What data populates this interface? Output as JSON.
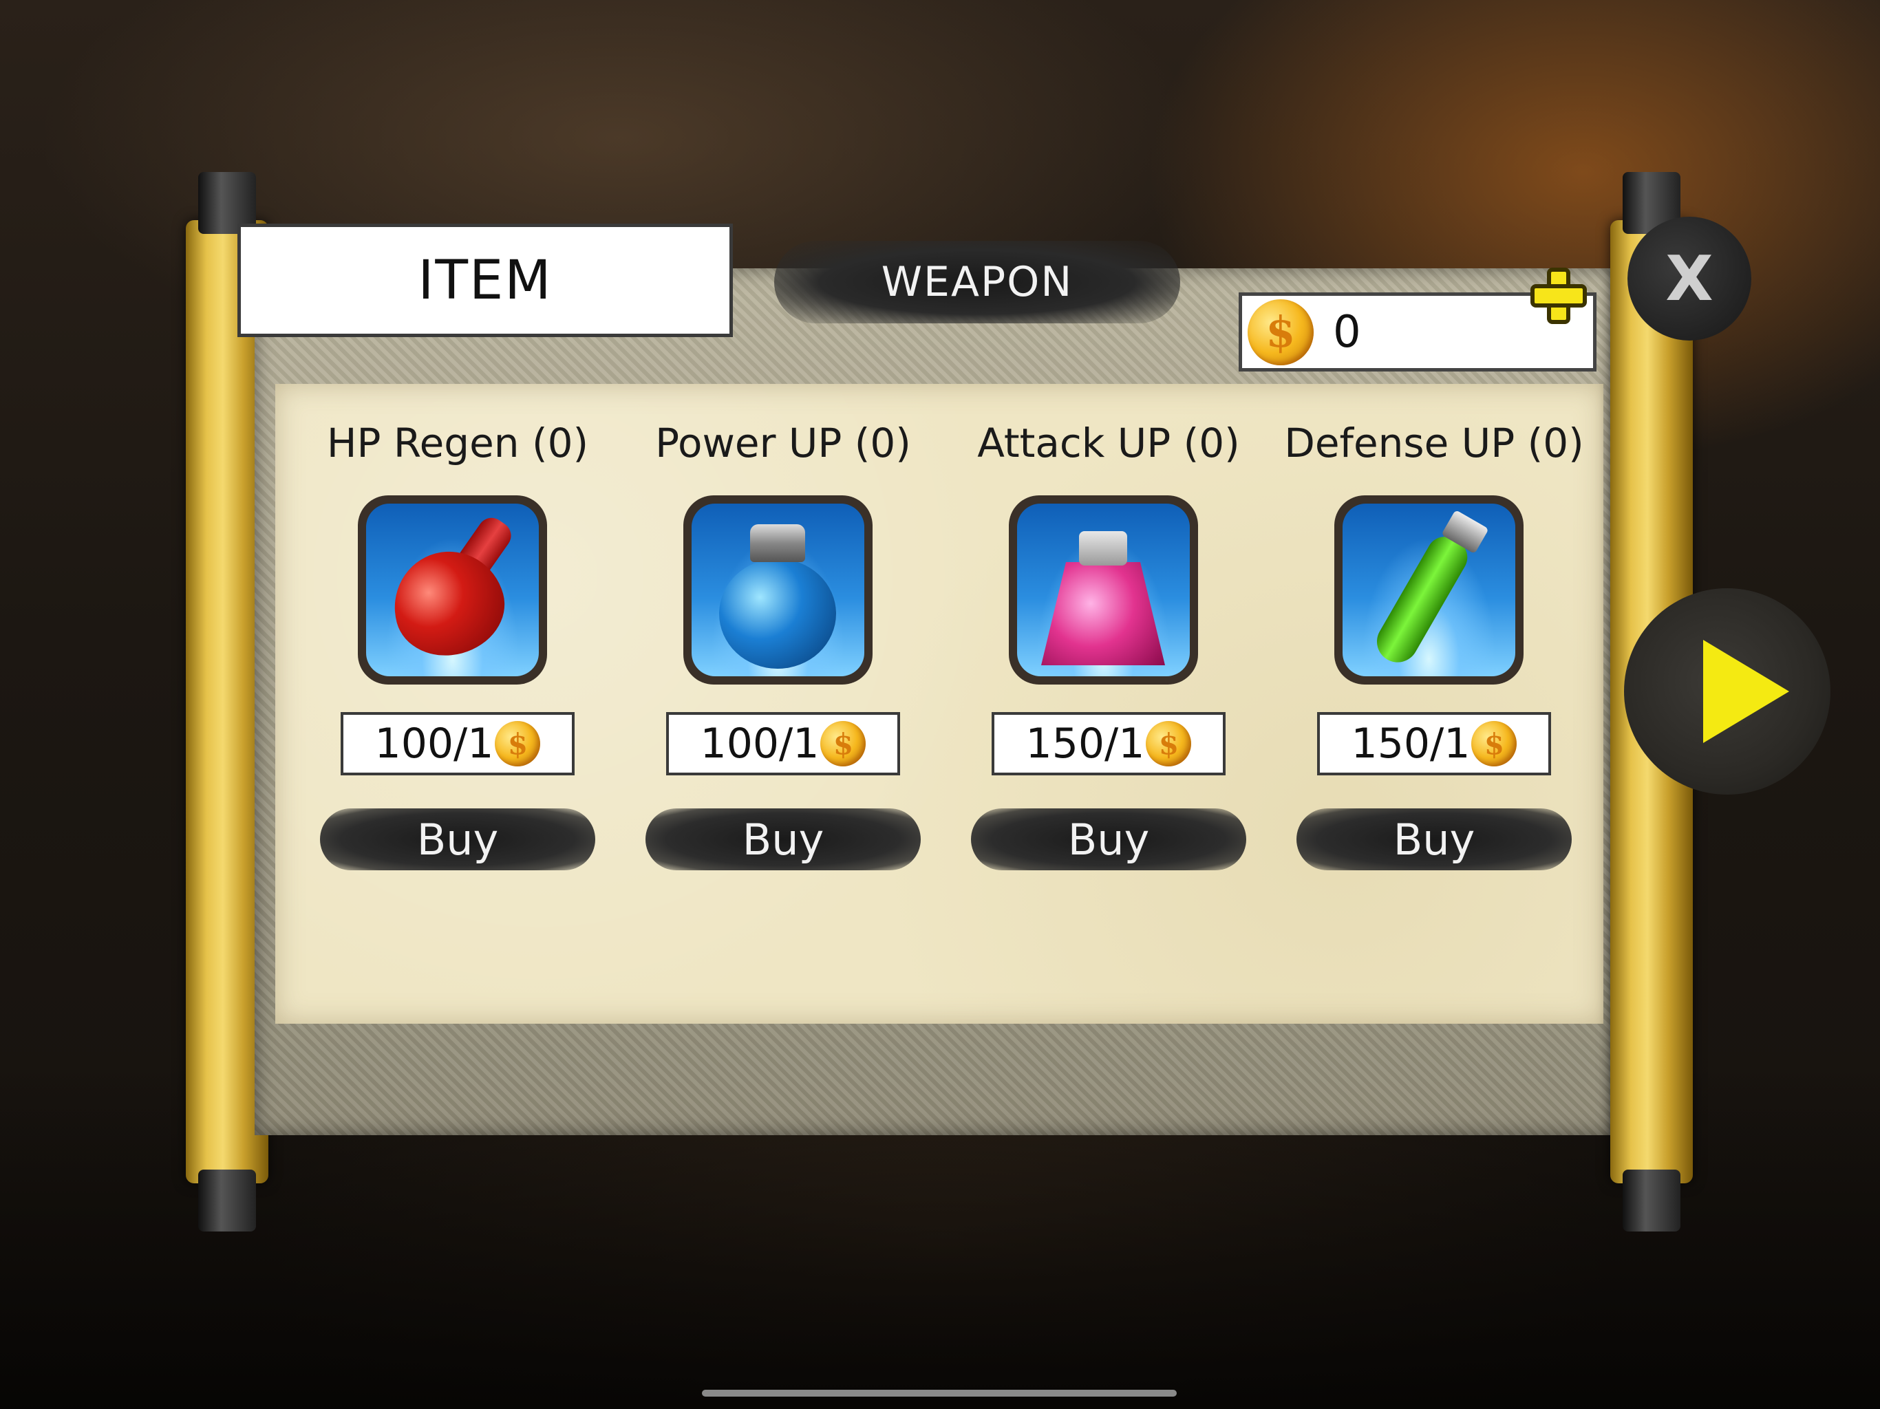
{
  "tabs": {
    "item_label": "ITEM",
    "weapon_label": "WEAPON",
    "active": "ITEM"
  },
  "wallet": {
    "coins": "0",
    "coin_symbol": "$"
  },
  "controls": {
    "close_label": "X"
  },
  "items": [
    {
      "title": "HP Regen (0)",
      "price": "100/1",
      "buy_label": "Buy",
      "icon": "red-potion-icon"
    },
    {
      "title": "Power UP (0)",
      "price": "100/1",
      "buy_label": "Buy",
      "icon": "blue-potion-icon"
    },
    {
      "title": "Attack UP (0)",
      "price": "150/1",
      "buy_label": "Buy",
      "icon": "pink-potion-icon"
    },
    {
      "title": "Defense UP (0)",
      "price": "150/1",
      "buy_label": "Buy",
      "icon": "green-potion-icon"
    }
  ],
  "colors": {
    "paper": "#efe6c4",
    "scroll_rod": "#e6c24a",
    "accent_yellow": "#f4ea12",
    "button_dark": "#2c2c2c"
  }
}
